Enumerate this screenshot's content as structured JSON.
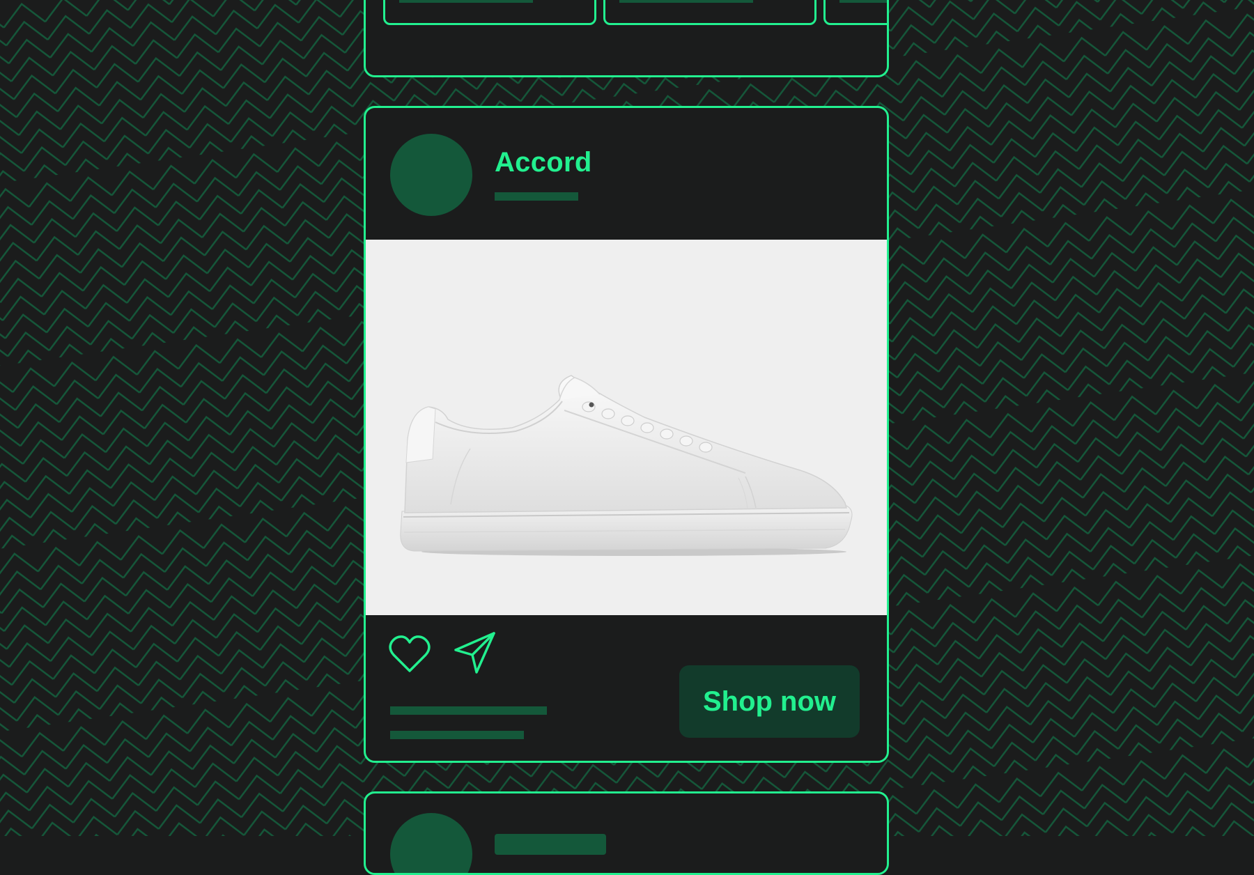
{
  "colors": {
    "background": "#1b1c1c",
    "accent": "#22f08f",
    "accent_dim": "#14583a",
    "button_bg": "#123b2b",
    "image_bg": "#efefef"
  },
  "post": {
    "brand_name": "Accord",
    "image_icon": "white-sneaker-product-photo",
    "like_icon": "heart-icon",
    "share_icon": "send-icon",
    "cta_label": "Shop now"
  }
}
